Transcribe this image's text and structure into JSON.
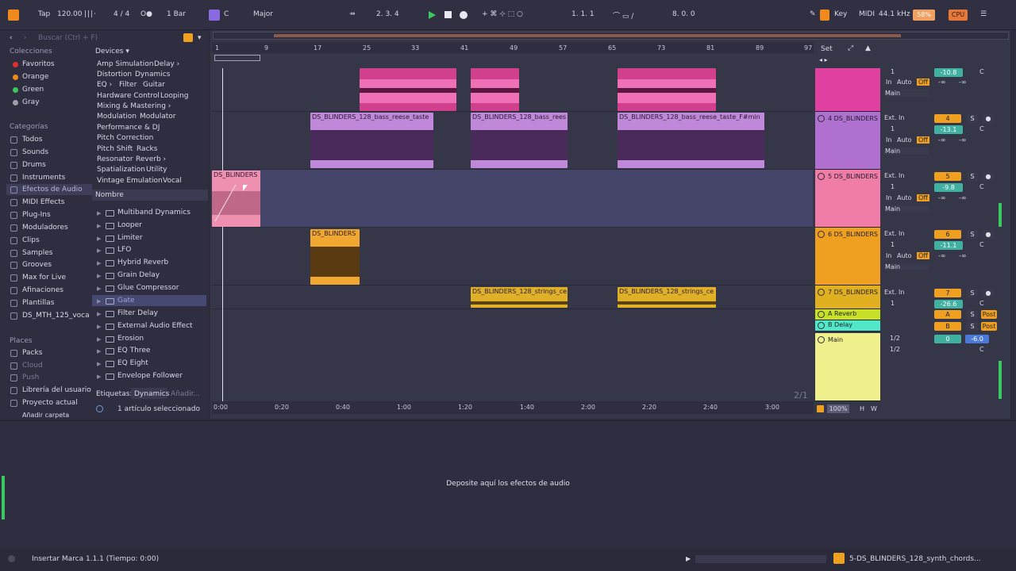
{
  "transport": {
    "tap": "Tap",
    "tempo": "120.00",
    "meter": "4 / 4",
    "quant": "1 Bar",
    "key": "C",
    "scale": "Major",
    "position": "2.  3.  4",
    "loop_start": "1.  1.  1",
    "loop_len": "8.  0.  0",
    "key_btn": "Key",
    "midi_btn": "MIDI",
    "sample_rate": "44.1 kHz",
    "cpu_pct": "58%",
    "cpu_label": "CPU"
  },
  "browser": {
    "search_placeholder": "Buscar (Ctrl + F)",
    "colecciones_title": "Colecciones",
    "collections": [
      {
        "label": "Favoritos",
        "color": "#e23030"
      },
      {
        "label": "Orange",
        "color": "#f08a1c"
      },
      {
        "label": "Green",
        "color": "#3cc860"
      },
      {
        "label": "Gray",
        "color": "#a0a0a8"
      }
    ],
    "categorias_title": "Categorías",
    "categories": [
      "Todos",
      "Sounds",
      "Drums",
      "Instruments",
      "Efectos de Audio",
      "MIDI Effects",
      "Plug-Ins",
      "Moduladores",
      "Clips",
      "Samples",
      "Grooves",
      "Max for Live",
      "Afinaciones",
      "Plantillas",
      "DS_MTH_125_voca"
    ],
    "places_title": "Places",
    "places": [
      "Packs",
      "Cloud",
      "Push",
      "Librería del usuario",
      "Proyecto actual",
      "Añadir carpeta"
    ],
    "devices_title": "Devices ▾",
    "tags": [
      [
        "Amp Simulation",
        "Delay ›"
      ],
      [
        "Distortion",
        "Dynamics"
      ],
      [
        "EQ ›",
        "Filter",
        "Guitar"
      ],
      [
        "Hardware Control",
        "Looping"
      ],
      [
        "Mixing & Mastering ›"
      ],
      [
        "Modulation",
        "Modulator"
      ],
      [
        "Performance & DJ"
      ],
      [
        "Pitch Correction"
      ],
      [
        "Pitch Shift",
        "Racks"
      ],
      [
        "Resonator",
        "Reverb ›"
      ],
      [
        "Spatialization",
        "Utility"
      ],
      [
        "Vintage Emulation",
        "Vocal"
      ]
    ],
    "name_header": "Nombre",
    "items": [
      "Multiband Dynamics",
      "Looper",
      "Limiter",
      "LFO",
      "Hybrid Reverb",
      "Grain Delay",
      "Glue Compressor",
      "Gate",
      "Filter Delay",
      "External Audio Effect",
      "Erosion",
      "EQ Three",
      "EQ Eight",
      "Envelope Follower"
    ],
    "etiquetas_label": "Etiquetas:",
    "etiquetas_tag": "Dynamics",
    "etiquetas_add": "Añadir...",
    "selected_info": "1 artículo seleccionado"
  },
  "arrangement": {
    "set_label": "Set",
    "bar_ticks": [
      "1",
      "9",
      "17",
      "25",
      "33",
      "41",
      "49",
      "57",
      "65",
      "73",
      "81",
      "89",
      "97"
    ],
    "time_ticks": [
      "0:00",
      "0:20",
      "0:40",
      "1:00",
      "1:20",
      "1:40",
      "2:00",
      "2:20",
      "2:40",
      "3:00"
    ],
    "zoom_fraction": "2/1",
    "zoom_percent": "100%",
    "h_btn": "H",
    "w_btn": "W",
    "clips": {
      "bass1": "DS_BLINDERS_128_bass_reese_taste",
      "bass2": "DS_BLINDERS_128_bass_rees",
      "bass3": "DS_BLINDERS_128_bass_reese_taste_F#min",
      "synth": "DS_BLINDERS",
      "lead": "DS_BLINDERS",
      "str1": "DS_BLINDERS_128_strings_ce",
      "str2": "DS_BLINDERS_128_strings_ce"
    }
  },
  "mixer": {
    "tracks": [
      {
        "name": "",
        "color": "#e040a0",
        "input": "",
        "chan": "1",
        "num": "",
        "vol": "-10.8",
        "auto": "Auto",
        "off": "Off",
        "inf1": "-∞",
        "inf2": "-∞",
        "out": "Main"
      },
      {
        "name": "4 DS_BLINDERS",
        "color": "#b070d0",
        "input": "Ext. In",
        "chan": "1",
        "num": "4",
        "vol": "-13.1",
        "auto": "Auto",
        "off": "Off",
        "inf1": "-∞",
        "inf2": "-∞",
        "out": "Main"
      },
      {
        "name": "5 DS_BLINDERS",
        "color": "#f07ca8",
        "input": "Ext. In",
        "chan": "1",
        "num": "5",
        "vol": "-9.8",
        "auto": "Auto",
        "off": "Off",
        "inf1": "-∞",
        "inf2": "-∞",
        "out": "Main"
      },
      {
        "name": "6 DS_BLINDERS",
        "color": "#f0a020",
        "input": "Ext. In",
        "chan": "1",
        "num": "6",
        "vol": "-11.1",
        "auto": "Auto",
        "off": "Off",
        "inf1": "-∞",
        "inf2": "-∞",
        "out": "Main"
      },
      {
        "name": "7 DS_BLINDERS",
        "color": "#e0b020",
        "input": "Ext. In",
        "chan": "1",
        "num": "7",
        "vol": "-26.6"
      }
    ],
    "returns": [
      {
        "name": "A Reverb",
        "letter": "A",
        "post": "Post",
        "color": "#c8e028"
      },
      {
        "name": "B Delay",
        "letter": "B",
        "post": "Post",
        "color": "#50e8c8"
      }
    ],
    "main": {
      "name": "Main",
      "color": "#f0f08c",
      "out1": "1/2",
      "out2": "1/2",
      "num": "0",
      "vol": "-6.0"
    },
    "in_label": "In",
    "s_label": "S",
    "c_label": "C"
  },
  "device_view": {
    "drop_text": "Deposite aquí los efectos de audio"
  },
  "status": {
    "text": "Insertar Marca 1.1.1 (Tiempo: 0:00)",
    "clip_name": "5-DS_BLINDERS_128_synth_chords..."
  }
}
